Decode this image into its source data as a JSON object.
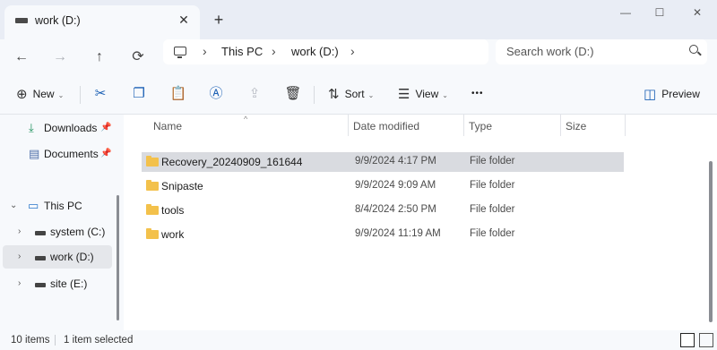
{
  "tab": {
    "title": "work (D:)",
    "close": "✕",
    "new_tab": "+"
  },
  "window_controls": {
    "minimize": "—",
    "maximize": "☐",
    "close": "✕"
  },
  "nav": {
    "back": "←",
    "forward": "→",
    "up": "↑",
    "refresh": "⟳"
  },
  "breadcrumb": {
    "items": [
      "This PC",
      "work (D:)"
    ],
    "separator": "›"
  },
  "search": {
    "placeholder": "Search work (D:)"
  },
  "toolbar": {
    "new_label": "New",
    "sort_label": "Sort",
    "view_label": "View",
    "more_label": "•••",
    "preview_label": "Preview"
  },
  "sidebar": {
    "quick": [
      {
        "label": "Downloads",
        "icon": "download-icon",
        "pinned": true
      },
      {
        "label": "Documents",
        "icon": "document-icon",
        "pinned": true
      }
    ],
    "this_pc": "This PC",
    "drives": [
      {
        "label": "system (C:)",
        "selected": false
      },
      {
        "label": "work (D:)",
        "selected": true
      },
      {
        "label": "site (E:)",
        "selected": false
      }
    ]
  },
  "columns": {
    "name": "Name",
    "date": "Date modified",
    "type": "Type",
    "size": "Size"
  },
  "files": [
    {
      "name": "Recovery_20240909_161644",
      "date": "9/9/2024 4:17 PM",
      "type": "File folder",
      "selected": true
    },
    {
      "name": "Snipaste",
      "date": "9/9/2024 9:09 AM",
      "type": "File folder",
      "selected": false
    },
    {
      "name": "tools",
      "date": "8/4/2024 2:50 PM",
      "type": "File folder",
      "selected": false
    },
    {
      "name": "work",
      "date": "9/9/2024 11:19 AM",
      "type": "File folder",
      "selected": false
    }
  ],
  "status": {
    "count": "10 items",
    "selection": "1 item selected"
  },
  "colors": {
    "accent": "#1a5fb4",
    "folder": "#f3c14b",
    "selected_row": "#d9dbe0"
  }
}
